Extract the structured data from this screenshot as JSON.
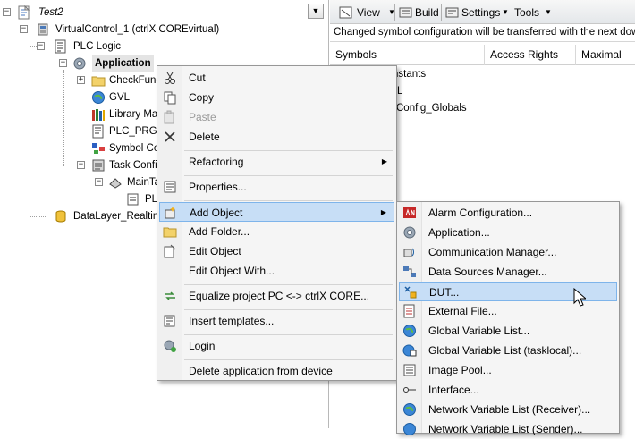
{
  "tree": {
    "project": "Test2",
    "device": "VirtualControl_1 (ctrlX COREvirtual)",
    "plc_logic": "PLC Logic",
    "application": "Application",
    "check_functions": "CheckFunc",
    "gvl": "GVL",
    "library_manager": "Library Mar",
    "plc_prg": "PLC_PRG (I",
    "symbol_config": "Symbol Cor",
    "task_config": "Task Config",
    "main_task": "MainTa",
    "plc_prg_task": "PL",
    "datalayer": "DataLayer_Realtim"
  },
  "toolbar": {
    "view": "View",
    "build": "Build",
    "settings": "Settings",
    "tools": "Tools"
  },
  "info_text": "Changed symbol configuration will be transferred with the next dow",
  "symbols": {
    "headers": [
      "Symbols",
      "Access Rights",
      "Maximal"
    ],
    "rows": [
      "nstants",
      "L",
      "Config_Globals"
    ]
  },
  "context_menu": {
    "cut": "Cut",
    "copy": "Copy",
    "paste": "Paste",
    "delete": "Delete",
    "refactoring": "Refactoring",
    "properties": "Properties...",
    "add_object": "Add Object",
    "add_folder": "Add Folder...",
    "edit_object": "Edit Object",
    "edit_object_with": "Edit Object With...",
    "equalize": "Equalize project PC <-> ctrlX CORE...",
    "insert_templates": "Insert templates...",
    "login": "Login",
    "delete_app": "Delete application from device"
  },
  "submenu": {
    "alarm": "Alarm Configuration...",
    "application": "Application...",
    "comm_manager": "Communication Manager...",
    "data_sources": "Data Sources Manager...",
    "dut": "DUT...",
    "external_file": "External File...",
    "gvl": "Global Variable List...",
    "gvl_tasklocal": "Global Variable List (tasklocal)...",
    "image_pool": "Image Pool...",
    "interface": "Interface...",
    "nvl_receiver": "Network Variable List (Receiver)...",
    "nvl_sender": "Network Variable List (Sender)..."
  },
  "colors": {
    "highlight": "#c7def6",
    "highlight_border": "#7eb4ea",
    "menu_bg": "#f5f5f5",
    "disabled_text": "#9b9b9b"
  }
}
